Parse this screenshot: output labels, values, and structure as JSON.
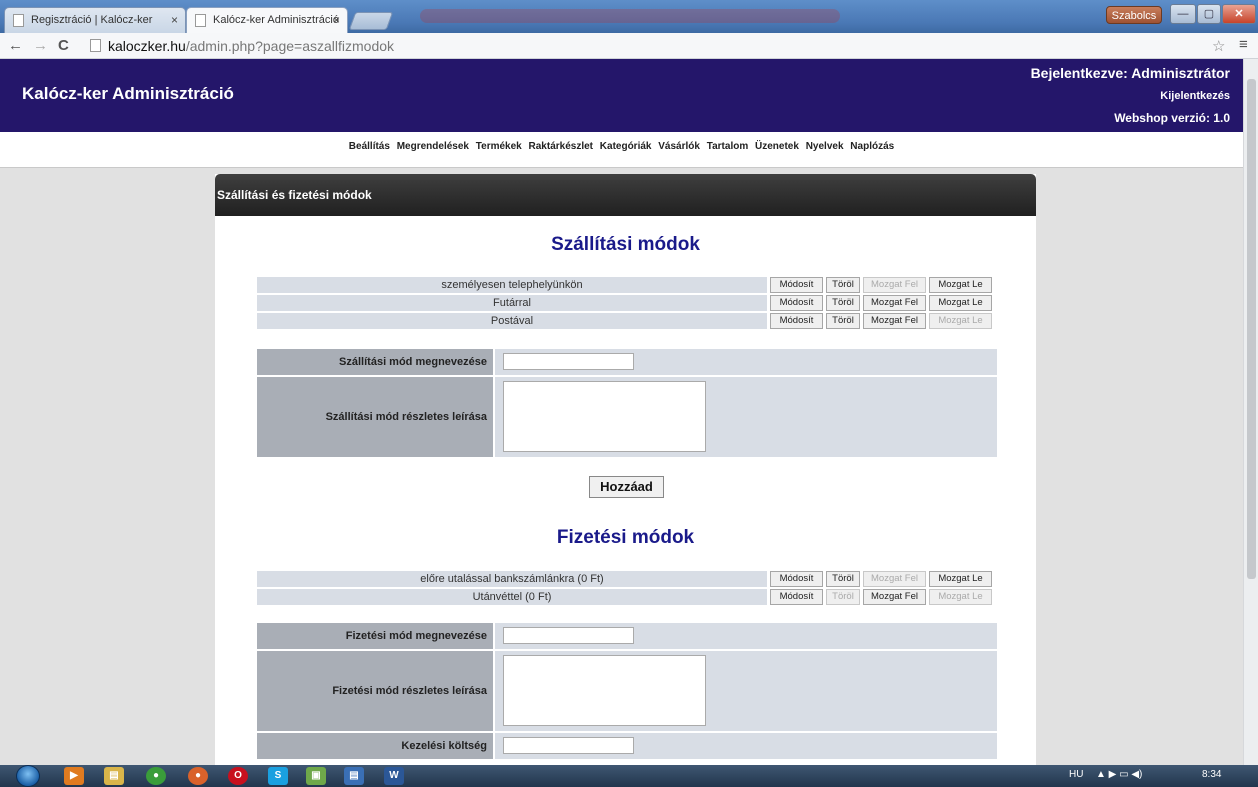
{
  "browser": {
    "tabs": [
      {
        "title": "Regisztráció | Kalócz-ker"
      },
      {
        "title": "Kalócz-ker Adminisztráció"
      }
    ],
    "user": "Szabolcs",
    "url_host": "kaloczker.hu",
    "url_path": "/admin.php?page=aszallfizmodok"
  },
  "header": {
    "title": "Kalócz-ker Adminisztráció",
    "login": "Bejelentkezve: Adminisztrátor",
    "logout": "Kijelentkezés",
    "version": "Webshop verzió: 1.0"
  },
  "nav": [
    "Beállítás",
    "Megrendelések",
    "Termékek",
    "Raktárkészlet",
    "Kategóriák",
    "Vásárlók",
    "Tartalom",
    "Üzenetek",
    "Nyelvek",
    "Naplózás"
  ],
  "panel": {
    "title": "Szállítási és fizetési módok"
  },
  "buttons": {
    "edit": "Módosít",
    "delete": "Töröl",
    "move_up": "Mozgat Fel",
    "move_down": "Mozgat Le",
    "add": "Hozzáad"
  },
  "shipping": {
    "title": "Szállítási módok",
    "items": [
      {
        "name": "személyesen telephelyünkön"
      },
      {
        "name": "Futárral"
      },
      {
        "name": "Postával"
      }
    ],
    "name_label": "Szállítási mód megnevezése",
    "desc_label": "Szállítási mód részletes leírása"
  },
  "payment": {
    "title": "Fizetési módok",
    "items": [
      {
        "name": "előre utalással bankszámlánkra (0 Ft)"
      },
      {
        "name": "Utánvéttel (0 Ft)"
      }
    ],
    "name_label": "Fizetési mód megnevezése",
    "desc_label": "Fizetési mód részletes leírása",
    "fee_label": "Kezelési költség"
  },
  "taskbar": {
    "lang": "HU",
    "time": "8:34"
  }
}
